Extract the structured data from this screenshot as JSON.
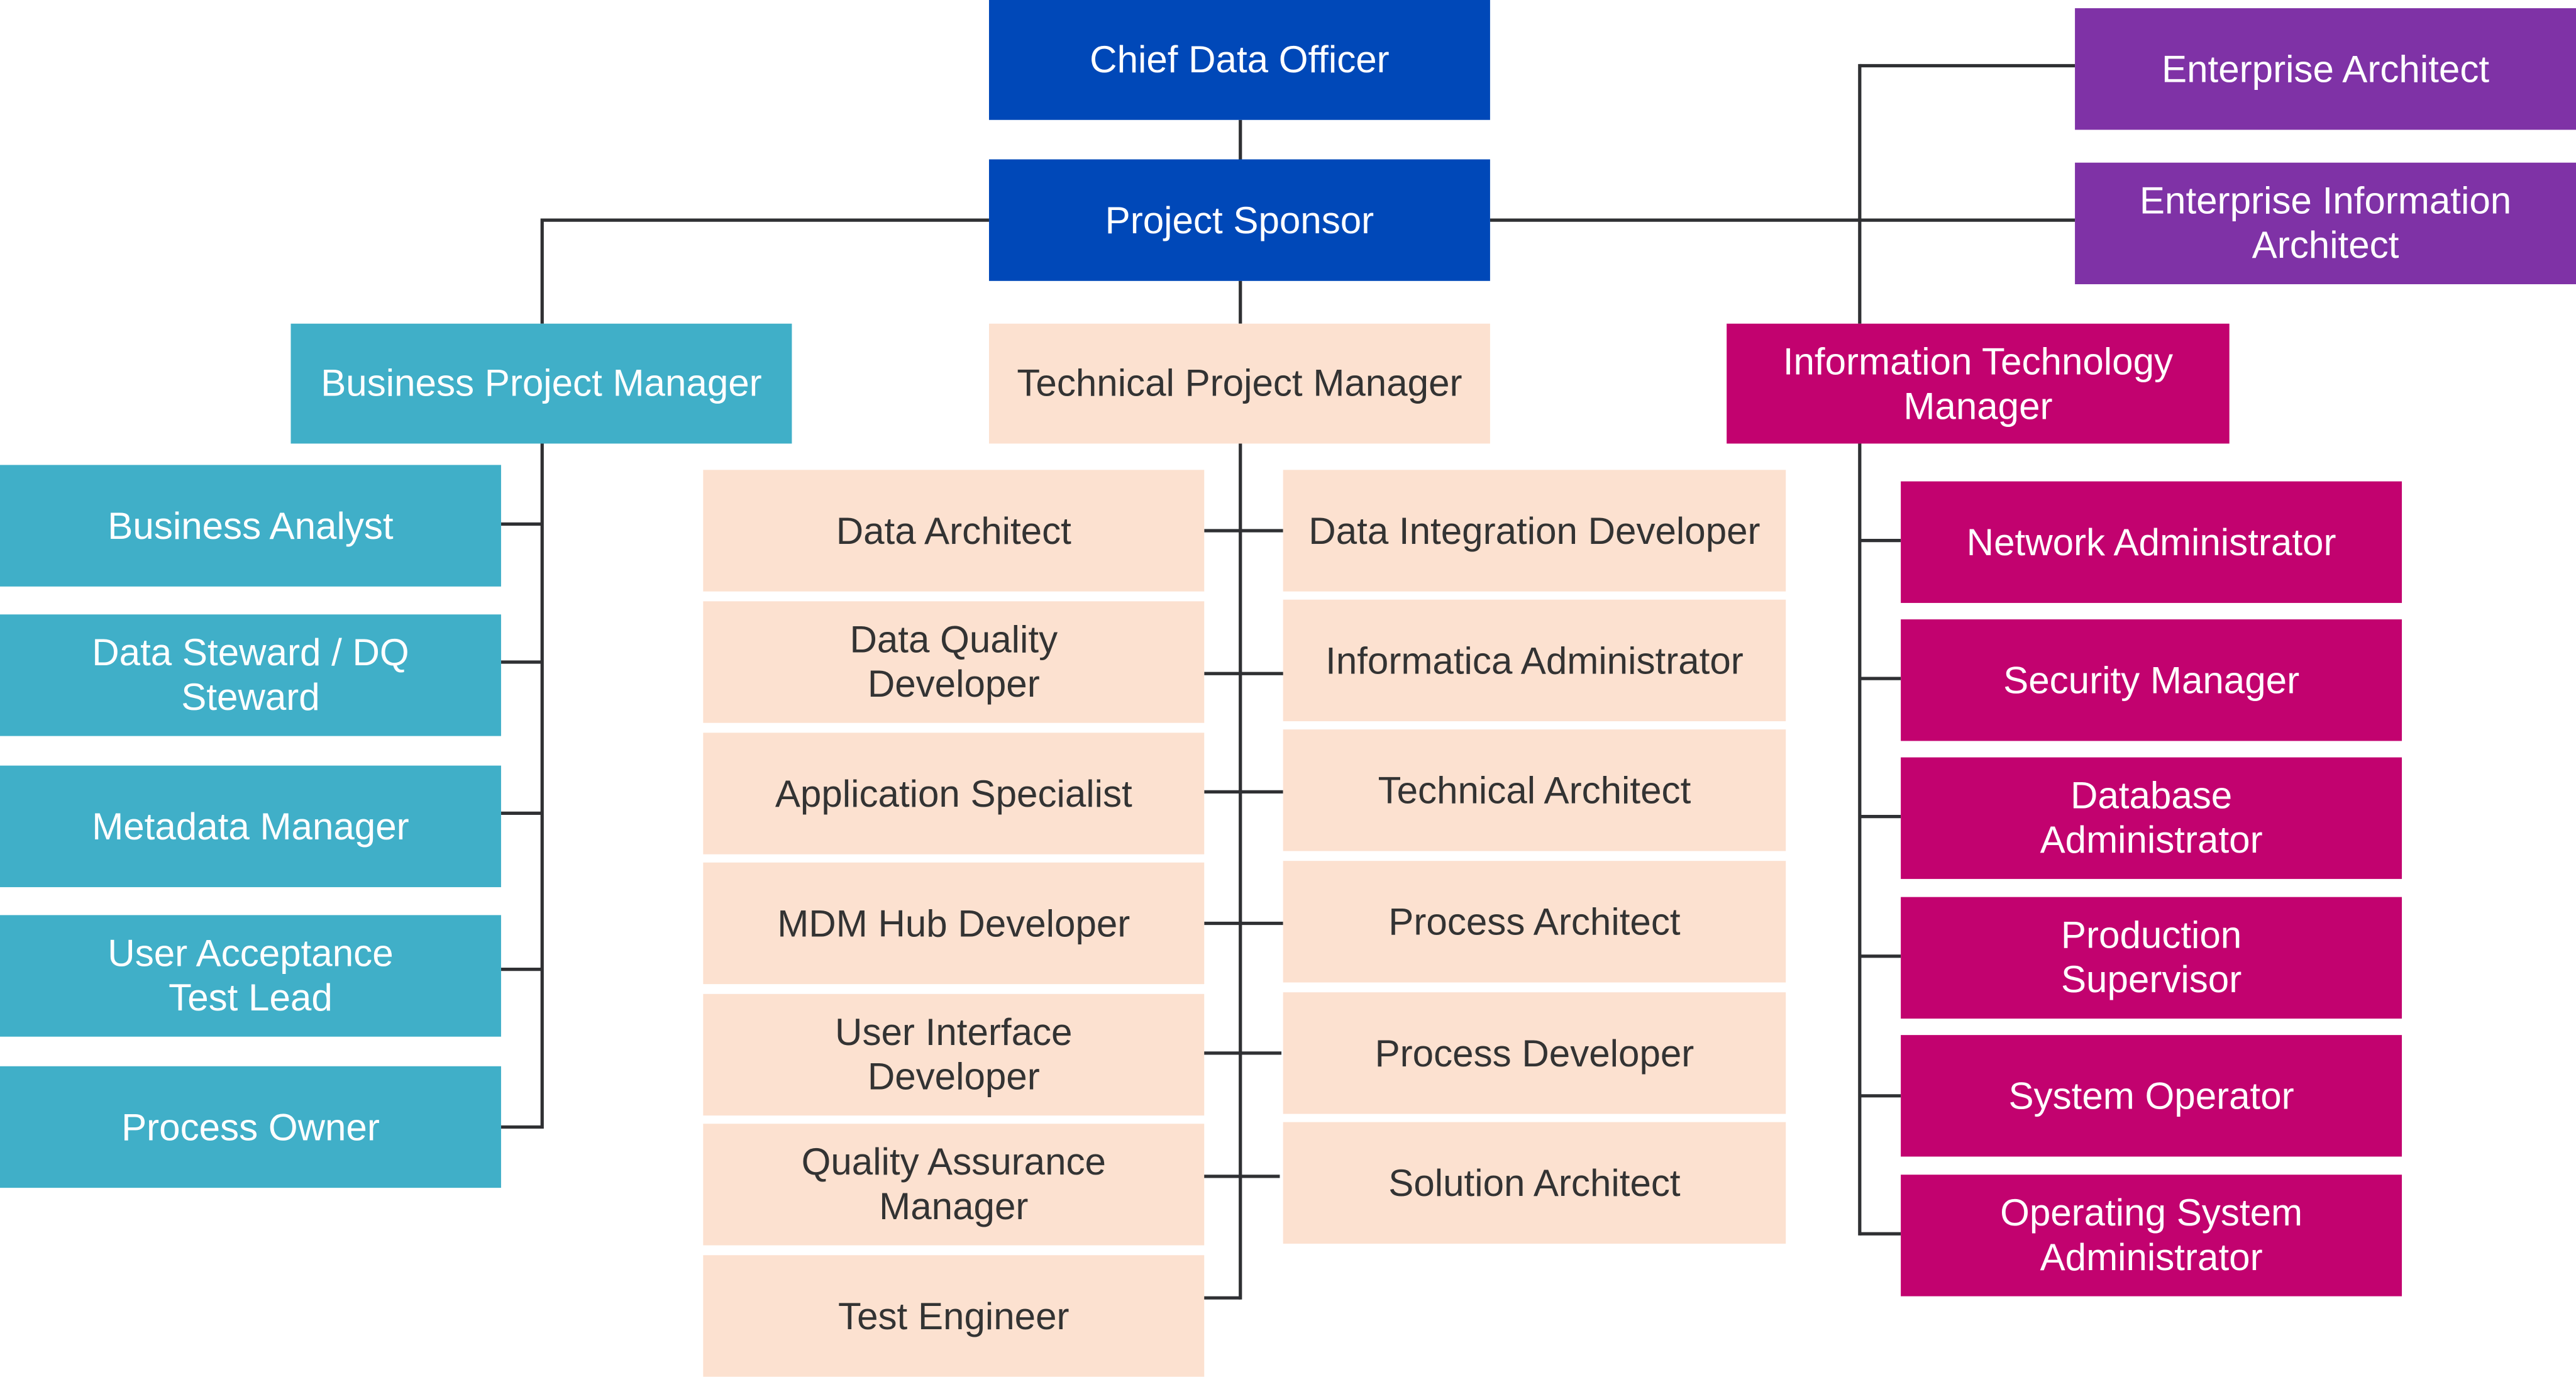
{
  "diagram": {
    "top": [
      {
        "label": "Chief Data Officer",
        "color": "#0048b8"
      },
      {
        "label": "Project Sponsor",
        "color": "#0048b8"
      }
    ],
    "architects": [
      {
        "label": "Enterprise Architect",
        "color": "#7f32a6"
      },
      {
        "label": "Enterprise Information Architect",
        "color": "#7f32a6"
      }
    ],
    "managers": [
      {
        "label": "Business Project Manager",
        "color": "#40afc8"
      },
      {
        "label": "Technical Project Manager",
        "color": "#fce1d0"
      },
      {
        "label": "Information Technology Manager",
        "color": "#c2026f"
      }
    ],
    "business_team": [
      "Business Analyst",
      "Data Steward / DQ Steward",
      "Metadata Manager",
      "User Acceptance Test Lead",
      "Process Owner"
    ],
    "technical_team_left": [
      "Data Architect",
      "Data Quality Developer",
      "Application Specialist",
      "MDM Hub Developer",
      "User Interface Developer",
      "Quality Assurance Manager",
      "Test Engineer"
    ],
    "technical_team_right": [
      "Data Integration Developer",
      "Informatica Administrator",
      "Technical Architect",
      "Process Architect",
      "Process Developer",
      "Solution Architect"
    ],
    "it_team": [
      "Network Administrator",
      "Security Manager",
      "Database Administrator",
      "Production Supervisor",
      "System Operator",
      "Operating System Administrator"
    ]
  }
}
